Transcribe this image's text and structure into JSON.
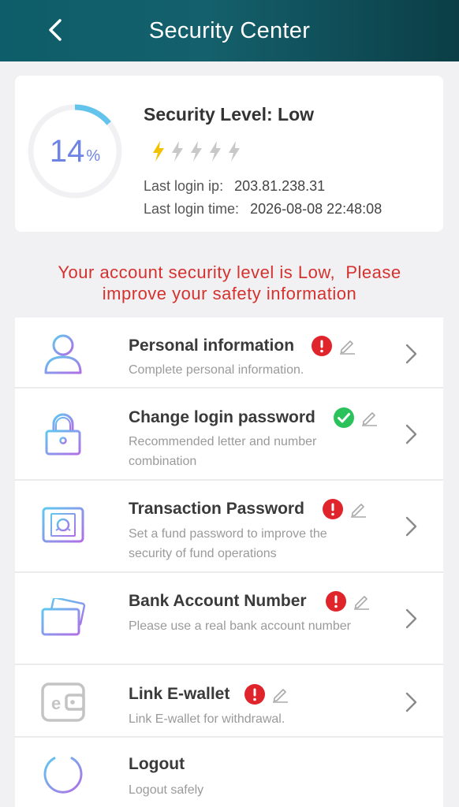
{
  "header": {
    "title": "Security Center"
  },
  "security": {
    "percent": "14",
    "percent_sign": "%",
    "level_label": "Security Level: Low",
    "lightning_active": 1,
    "lightning_total": 5,
    "last_ip_label": "Last login ip:",
    "last_ip": "203.81.238.31",
    "last_time_label": "Last login time:",
    "last_time": "2026-08-08 22:48:08"
  },
  "warning": {
    "line1": "Your account security level is Low,  Please",
    "line2": "improve your safety information"
  },
  "items": [
    {
      "title": "Personal information",
      "desc": "Complete personal information.",
      "status": "warning"
    },
    {
      "title": "Change login password",
      "desc": "Recommended letter and number combination",
      "status": "ok"
    },
    {
      "title": "Transaction Password",
      "desc": "Set a fund password to improve the security of fund operations",
      "status": "warning"
    },
    {
      "title": "Bank Account Number",
      "desc": "Please use a real bank account number",
      "status": "warning"
    },
    {
      "title": "Link E-wallet",
      "desc": "Link E-wallet for withdrawal.",
      "status": "warning"
    },
    {
      "title": "Logout",
      "desc": "Logout safely",
      "status": "none"
    }
  ],
  "colors": {
    "accent": "#6e83e6",
    "warning_red": "#e0242b",
    "ok_green": "#2cc25b",
    "lightning_on": "#f2c200",
    "lightning_off": "#c8c8c8"
  },
  "icons": {
    "back": "chevron-left-icon",
    "personal": "user-icon",
    "password": "lock-icon",
    "transaction": "safe-icon",
    "bank": "bank-card-icon",
    "ewallet": "wallet-icon",
    "logout": "power-icon",
    "edit": "pencil-icon",
    "arrow": "chevron-right-icon"
  }
}
